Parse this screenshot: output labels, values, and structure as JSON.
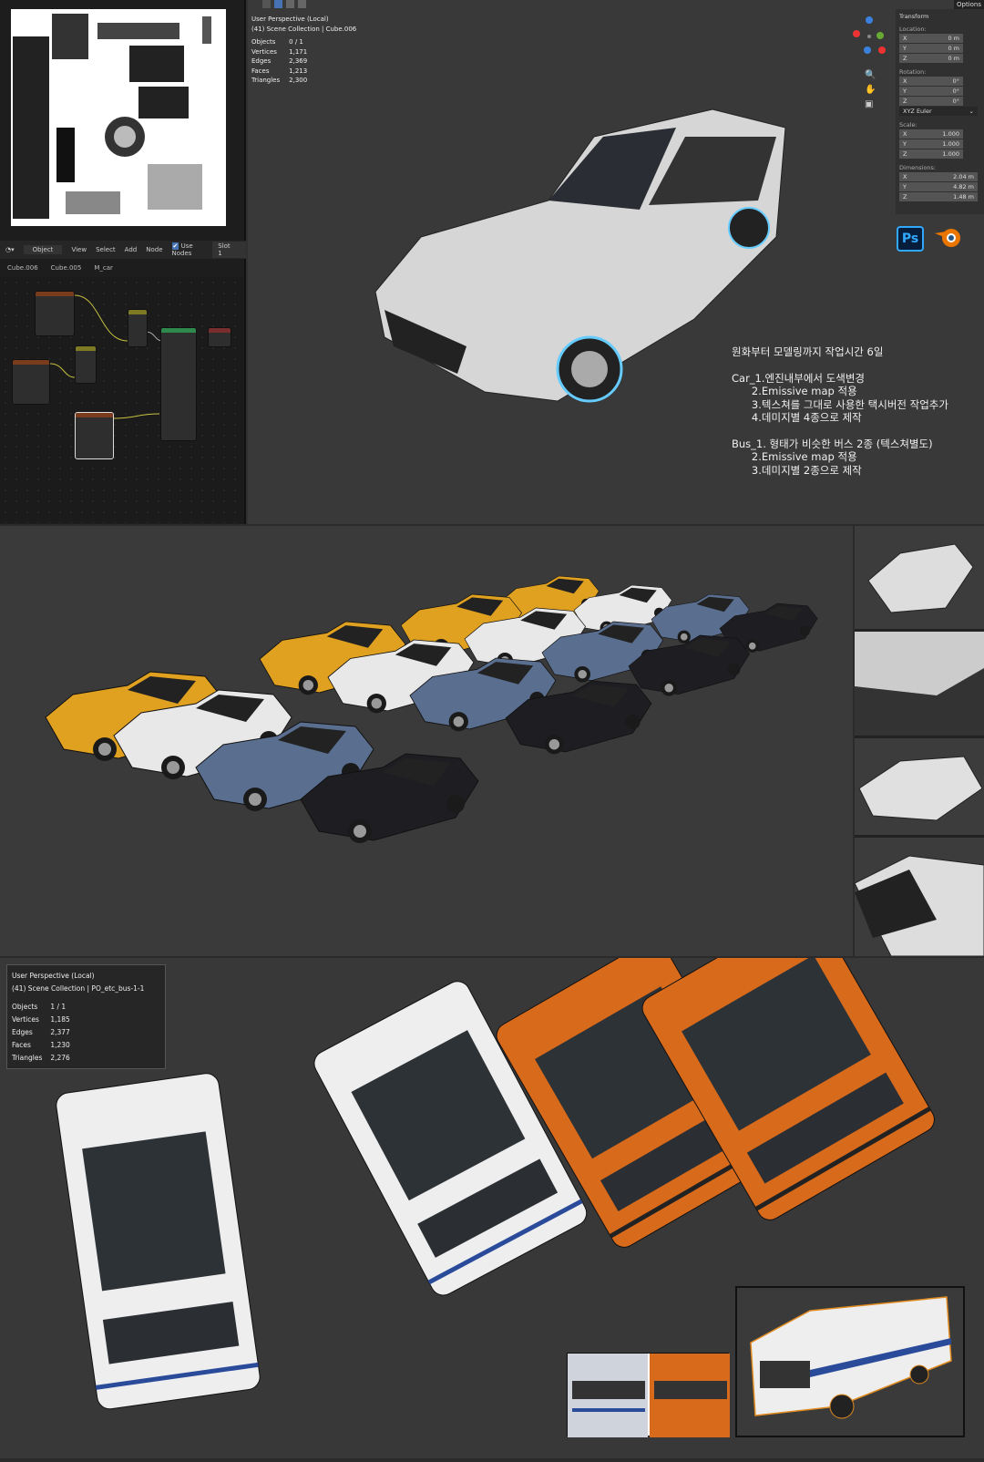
{
  "top_viewport": {
    "perspective": "User Perspective (Local)",
    "collection": "(41) Scene Collection | Cube.006",
    "stats": [
      [
        "Objects",
        "0 / 1"
      ],
      [
        "Vertices",
        "1,171"
      ],
      [
        "Edges",
        "2,369"
      ],
      [
        "Faces",
        "1,213"
      ],
      [
        "Triangles",
        "2,300"
      ]
    ],
    "options": "Options"
  },
  "node_editor": {
    "header": {
      "mode": "Object",
      "menu": [
        "View",
        "Select",
        "Add",
        "Node"
      ],
      "use_nodes": "Use Nodes",
      "slot": "Slot 1"
    },
    "breadcrumb": [
      "Cube.006",
      "Cube.005",
      "M_car"
    ]
  },
  "transform": {
    "title": "Transform",
    "location_label": "Location:",
    "location": [
      [
        "X",
        "0 m"
      ],
      [
        "Y",
        "0 m"
      ],
      [
        "Z",
        "0 m"
      ]
    ],
    "rotation_label": "Rotation:",
    "rotation": [
      [
        "X",
        "0°"
      ],
      [
        "Y",
        "0°"
      ],
      [
        "Z",
        "0°"
      ]
    ],
    "rotation_mode": "XYZ Euler",
    "scale_label": "Scale:",
    "scale": [
      [
        "X",
        "1.000"
      ],
      [
        "Y",
        "1.000"
      ],
      [
        "Z",
        "1.000"
      ]
    ],
    "dimensions_label": "Dimensions:",
    "dimensions": [
      [
        "X",
        "2.04 m"
      ],
      [
        "Y",
        "4.82 m"
      ],
      [
        "Z",
        "1.48 m"
      ]
    ]
  },
  "logos": {
    "photoshop": "Ps",
    "blender": "blender-logo"
  },
  "notes": {
    "line1": "원화부터 모델링까지 작업시간 6일",
    "car": [
      "Car_1.엔진내부에서 도색변경",
      "      2.Emissive map 적용",
      "      3.텍스쳐를 그대로 사용한 택시버전 작업추가",
      "      4.데미지별 4종으로 제작"
    ],
    "bus": [
      "Bus_1. 형태가 비슷한 버스 2종 (텍스쳐별도)",
      "      2.Emissive map 적용",
      "      3.데미지별 2종으로 제작"
    ]
  },
  "bottom_viewport": {
    "perspective": "User Perspective (Local)",
    "collection": "(41) Scene Collection | PO_etc_bus-1-1",
    "stats": [
      [
        "Objects",
        "1 / 1"
      ],
      [
        "Vertices",
        "1,185"
      ],
      [
        "Edges",
        "2,377"
      ],
      [
        "Faces",
        "1,230"
      ],
      [
        "Triangles",
        "2,276"
      ]
    ]
  },
  "colors": {
    "taxi": "#e0a020",
    "white": "#e8e8e8",
    "blue": "#5a6f90",
    "black": "#1e1e22",
    "orange": "#d86a1c",
    "bus_white": "#eeeeee"
  }
}
